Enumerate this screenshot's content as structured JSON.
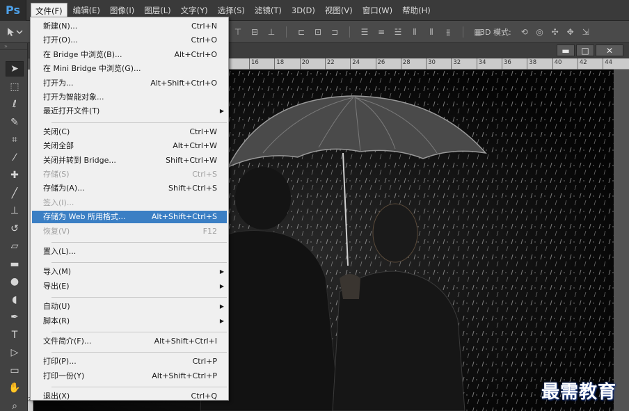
{
  "app": {
    "logo": "Ps"
  },
  "menubar": {
    "items": [
      {
        "label": "文件(F)"
      },
      {
        "label": "编辑(E)"
      },
      {
        "label": "图像(I)"
      },
      {
        "label": "图层(L)"
      },
      {
        "label": "文字(Y)"
      },
      {
        "label": "选择(S)"
      },
      {
        "label": "滤镜(T)"
      },
      {
        "label": "3D(D)"
      },
      {
        "label": "视图(V)"
      },
      {
        "label": "窗口(W)"
      },
      {
        "label": "帮助(H)"
      }
    ],
    "active_index": 0
  },
  "optionsbar": {
    "mode_3d_label": "3D 模式:",
    "icons": [
      "align-top-icon",
      "align-vcenter-icon",
      "align-bottom-icon",
      "align-left-icon",
      "align-hcenter-icon",
      "align-right-icon",
      "distribute-top-icon",
      "distribute-vcenter-icon",
      "distribute-bottom-icon",
      "distribute-left-icon",
      "distribute-hcenter-icon",
      "distribute-right-icon",
      "auto-align-icon"
    ],
    "icons_3d": [
      "orbit-icon",
      "roll-icon",
      "pan-icon",
      "slide-icon",
      "scale-3d-icon"
    ]
  },
  "toolbar": {
    "tools": [
      "move-tool-icon",
      "marquee-tool-icon",
      "lasso-tool-icon",
      "quick-select-tool-icon",
      "crop-tool-icon",
      "eyedropper-tool-icon",
      "healing-brush-tool-icon",
      "brush-tool-icon",
      "clone-stamp-tool-icon",
      "history-brush-tool-icon",
      "eraser-tool-icon",
      "gradient-tool-icon",
      "blur-tool-icon",
      "dodge-tool-icon",
      "pen-tool-icon",
      "type-tool-icon",
      "path-select-tool-icon",
      "shape-tool-icon",
      "hand-tool-icon",
      "zoom-tool-icon"
    ]
  },
  "document": {
    "ruler_labels": [
      "16",
      "18",
      "20",
      "22",
      "24",
      "26",
      "28",
      "30",
      "32",
      "34",
      "36",
      "38",
      "40",
      "42",
      "44"
    ],
    "left_ruler_label": "2",
    "window_buttons": {
      "minimize": "▬",
      "maximize": "□",
      "close": "✕"
    }
  },
  "file_menu": {
    "groups": [
      [
        {
          "label": "新建(N)...",
          "shortcut": "Ctrl+N"
        },
        {
          "label": "打开(O)...",
          "shortcut": "Ctrl+O"
        },
        {
          "label": "在 Bridge 中浏览(B)...",
          "shortcut": "Alt+Ctrl+O"
        },
        {
          "label": "在 Mini Bridge 中浏览(G)...",
          "shortcut": ""
        },
        {
          "label": "打开为...",
          "shortcut": "Alt+Shift+Ctrl+O"
        },
        {
          "label": "打开为智能对象...",
          "shortcut": ""
        },
        {
          "label": "最近打开文件(T)",
          "shortcut": "",
          "submenu": true
        }
      ],
      [
        {
          "label": "关闭(C)",
          "shortcut": "Ctrl+W"
        },
        {
          "label": "关闭全部",
          "shortcut": "Alt+Ctrl+W"
        },
        {
          "label": "关闭并转到 Bridge...",
          "shortcut": "Shift+Ctrl+W"
        },
        {
          "label": "存储(S)",
          "shortcut": "Ctrl+S",
          "disabled": true
        },
        {
          "label": "存储为(A)...",
          "shortcut": "Shift+Ctrl+S"
        },
        {
          "label": "签入(I)...",
          "shortcut": "",
          "disabled": true
        },
        {
          "label": "存储为 Web 所用格式...",
          "shortcut": "Alt+Shift+Ctrl+S",
          "highlight": true
        },
        {
          "label": "恢复(V)",
          "shortcut": "F12",
          "disabled": true
        }
      ],
      [
        {
          "label": "置入(L)...",
          "shortcut": ""
        }
      ],
      [
        {
          "label": "导入(M)",
          "shortcut": "",
          "submenu": true
        },
        {
          "label": "导出(E)",
          "shortcut": "",
          "submenu": true
        }
      ],
      [
        {
          "label": "自动(U)",
          "shortcut": "",
          "submenu": true
        },
        {
          "label": "脚本(R)",
          "shortcut": "",
          "submenu": true
        }
      ],
      [
        {
          "label": "文件简介(F)...",
          "shortcut": "Alt+Shift+Ctrl+I"
        }
      ],
      [
        {
          "label": "打印(P)...",
          "shortcut": "Ctrl+P"
        },
        {
          "label": "打印一份(Y)",
          "shortcut": "Alt+Shift+Ctrl+P"
        }
      ],
      [
        {
          "label": "退出(X)",
          "shortcut": "Ctrl+Q"
        }
      ]
    ]
  },
  "watermark": "最需教育",
  "colors": {
    "highlight": "#3b7fc4",
    "menubar": "#3a3a3a",
    "logo": "#4da0e8"
  }
}
